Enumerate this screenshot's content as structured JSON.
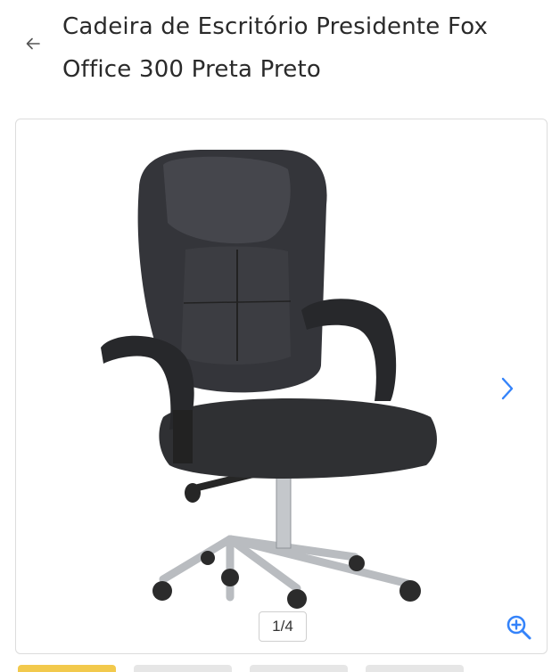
{
  "header": {
    "back_icon": "arrow-left-icon",
    "title": "Cadeira de Escritório Presidente Fox Office 300 Preta Preto"
  },
  "gallery": {
    "image_alt": "Cadeira de Escritório Presidente Fox Office 300 Preta Preto",
    "next_icon": "chevron-right-icon",
    "counter": "1/4",
    "zoom_icon": "zoom-in-icon",
    "accent_color": "#3483fa",
    "active_thumb_color": "#f2c94c"
  }
}
